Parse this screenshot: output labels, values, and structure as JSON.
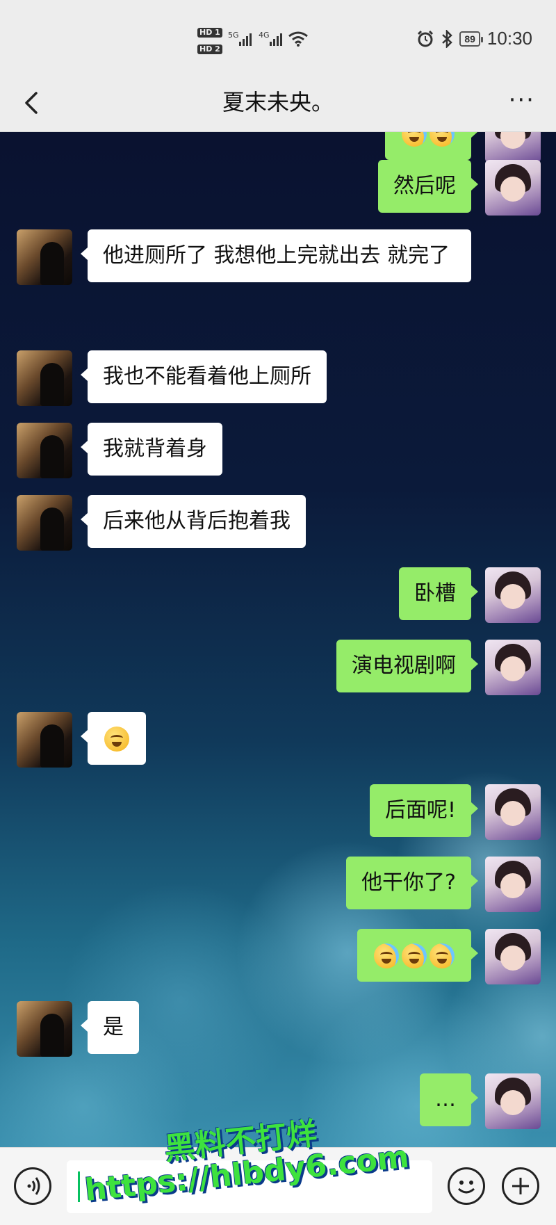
{
  "status_bar": {
    "hd1": "HD 1",
    "hd2": "HD 2",
    "net1": "5G",
    "net2": "4G",
    "battery": "89",
    "time": "10:30",
    "icons": [
      "signal-icon",
      "wifi-icon",
      "alarm-icon",
      "bluetooth-icon",
      "battery-icon"
    ]
  },
  "header": {
    "title": "夏末未央。",
    "back_icon": "chevron-left-icon",
    "more_icon": "more-icon",
    "more_label": "···"
  },
  "messages": [
    {
      "side": "right",
      "emojis": [
        "cry",
        "cry"
      ],
      "partial": true
    },
    {
      "side": "right",
      "text": "然后呢"
    },
    {
      "side": "left",
      "text": "他进厕所了 我想他上完就出去 就完了"
    },
    {
      "side": "left",
      "text": "我也不能看着他上厕所"
    },
    {
      "side": "left",
      "text": "我就背着身"
    },
    {
      "side": "left",
      "text": "后来他从背后抱着我"
    },
    {
      "side": "right",
      "text": "卧槽"
    },
    {
      "side": "right",
      "text": "演电视剧啊"
    },
    {
      "side": "left",
      "emojis": [
        "pleading"
      ]
    },
    {
      "side": "right",
      "text": "后面呢!"
    },
    {
      "side": "right",
      "text": "他干你了?"
    },
    {
      "side": "right",
      "emojis": [
        "cry",
        "cry",
        "cry"
      ]
    },
    {
      "side": "left",
      "text": "是"
    },
    {
      "side": "right",
      "text": "…"
    }
  ],
  "input_bar": {
    "voice_icon": "voice-icon",
    "emoji_icon": "emoji-icon",
    "plus_icon": "plus-icon",
    "input_value": ""
  },
  "watermark": {
    "line1": "黑料不打烊",
    "line2": "https://hlbdy6.com"
  }
}
